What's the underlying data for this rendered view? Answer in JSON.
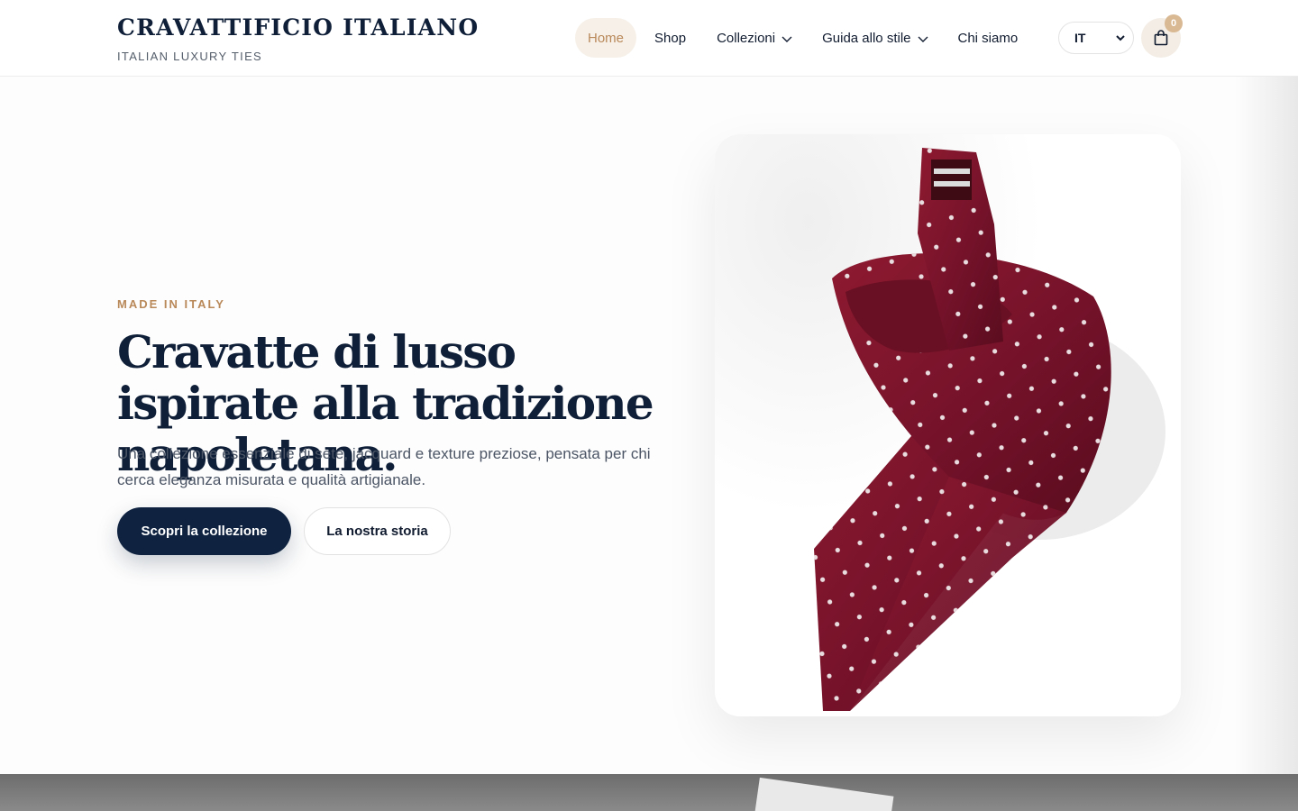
{
  "brand": {
    "name": "CRAVATTIFICIO ITALIANO",
    "tagline": "ITALIAN LUXURY TIES"
  },
  "nav": {
    "items": [
      {
        "label": "Home",
        "active": true,
        "dropdown": false
      },
      {
        "label": "Shop",
        "active": false,
        "dropdown": false
      },
      {
        "label": "Collezioni",
        "active": false,
        "dropdown": true
      },
      {
        "label": "Guida allo stile",
        "active": false,
        "dropdown": true
      },
      {
        "label": "Chi siamo",
        "active": false,
        "dropdown": false
      }
    ]
  },
  "language": {
    "selected": "IT"
  },
  "cart": {
    "count": "0",
    "icon": "shopping-bag-icon"
  },
  "hero": {
    "eyebrow": "MADE IN ITALY",
    "title": "Cravatte di lusso ispirate alla tradizione napoletana.",
    "subtitle": "Una collezione essenziale di sete, jacquard e texture preziose, pensata per chi cerca eleganza misurata e qualità artigianale.",
    "primary_cta": "Scopri la collezione",
    "secondary_cta": "La nostra storia",
    "image": "burgundy-polka-dot-tie"
  },
  "colors": {
    "navy": "#0f2340",
    "gold": "#b9895a",
    "active_bg": "#f6f0e8",
    "tie": "#7d1428"
  }
}
